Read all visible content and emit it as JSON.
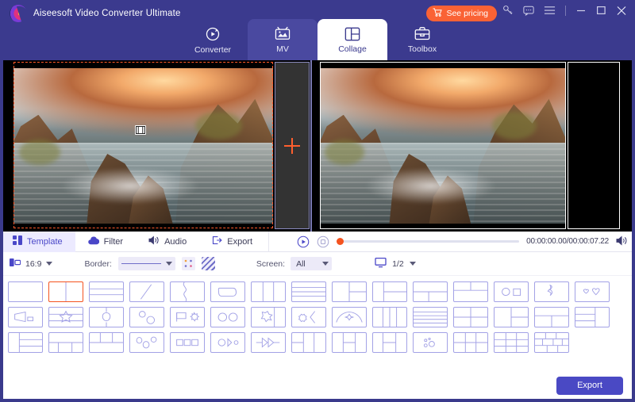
{
  "app": {
    "title": "Aiseesoft Video Converter Ultimate",
    "logo_icon": "aiseesoft-logo-icon"
  },
  "header": {
    "pricing_label": "See pricing",
    "cart_icon": "cart-icon",
    "key_icon": "key-icon",
    "feedback_icon": "chat-bubble-icon",
    "menu_icon": "hamburger-menu-icon",
    "minimize_icon": "minimize-icon",
    "maximize_icon": "maximize-icon",
    "close_icon": "close-icon",
    "tabs": [
      {
        "label": "Converter",
        "icon": "converter-icon",
        "state": "inactive"
      },
      {
        "label": "MV",
        "icon": "mv-icon",
        "state": "hover"
      },
      {
        "label": "Collage",
        "icon": "collage-icon",
        "state": "active"
      },
      {
        "label": "Toolbox",
        "icon": "toolbox-icon",
        "state": "inactive"
      }
    ]
  },
  "preview": {
    "empty_slot_icon": "add-plus-icon",
    "clip_marker_icon": "film-clip-icon"
  },
  "edit_tabs": [
    {
      "label": "Template",
      "icon": "template-icon",
      "active": true
    },
    {
      "label": "Filter",
      "icon": "filter-cloud-icon",
      "active": false
    },
    {
      "label": "Audio",
      "icon": "audio-speaker-icon",
      "active": false
    },
    {
      "label": "Export",
      "icon": "export-arrow-icon",
      "active": false
    }
  ],
  "player": {
    "play_icon": "play-circle-icon",
    "stop_icon": "stop-square-icon",
    "volume_icon": "volume-icon",
    "current_time": "00:00:00.00",
    "total_time": "00:00:07.22",
    "timecode": "00:00:00.00/00:00:07.22",
    "progress_percent": 0
  },
  "options": {
    "aspect_icon": "aspect-ratio-icon",
    "aspect_value": "16:9",
    "border_label": "Border:",
    "border_style_icon": "solid-line-icon",
    "border_dots_icon": "border-color-dots-icon",
    "border_pattern_icon": "border-pattern-stripes-icon",
    "screen_label": "Screen:",
    "screen_value": "All",
    "page_icon": "monitor-icon",
    "page_value": "1/2"
  },
  "templates": {
    "selected_index": 1,
    "items": [
      {
        "name": "single-full"
      },
      {
        "name": "split-vertical-2"
      },
      {
        "name": "split-horizontal-2"
      },
      {
        "name": "diagonal-split-2"
      },
      {
        "name": "wave-arrow-split"
      },
      {
        "name": "rounded-shape-frame"
      },
      {
        "name": "split-vertical-3"
      },
      {
        "name": "split-horizontal-3"
      },
      {
        "name": "left-big-right-2"
      },
      {
        "name": "left-narrow-right-2"
      },
      {
        "name": "top-wide-bottom-2"
      },
      {
        "name": "top-2-bottom-wide"
      },
      {
        "name": "circle-and-square"
      },
      {
        "name": "ribbon-shape"
      },
      {
        "name": "two-hearts"
      },
      {
        "name": "megaphone-shape"
      },
      {
        "name": "star-banner"
      },
      {
        "name": "balloon-shape"
      },
      {
        "name": "two-circles-diagonal"
      },
      {
        "name": "flag-and-burst"
      },
      {
        "name": "two-circles"
      },
      {
        "name": "puzzle-piece"
      },
      {
        "name": "gear-and-arrow"
      },
      {
        "name": "arch-with-star"
      },
      {
        "name": "split-vertical-4"
      },
      {
        "name": "split-horizontal-4"
      },
      {
        "name": "quad-grid"
      },
      {
        "name": "left-big-right-2b"
      },
      {
        "name": "top-big-bottom-2"
      },
      {
        "name": "right-big-left-2"
      },
      {
        "name": "left-wide-right-stack"
      },
      {
        "name": "bottom-3-top-wide"
      },
      {
        "name": "top-3-bottom-wide"
      },
      {
        "name": "three-ovals"
      },
      {
        "name": "three-squares"
      },
      {
        "name": "oval-and-shapes"
      },
      {
        "name": "triple-arrows"
      },
      {
        "name": "grid-2x2-wide"
      },
      {
        "name": "grid-2x2-offset"
      },
      {
        "name": "grid-mixed-3"
      },
      {
        "name": "bubbles-cluster"
      },
      {
        "name": "grid-2x3"
      },
      {
        "name": "grid-3x3"
      },
      {
        "name": "grid-mosaic"
      }
    ]
  },
  "footer": {
    "export_label": "Export"
  }
}
